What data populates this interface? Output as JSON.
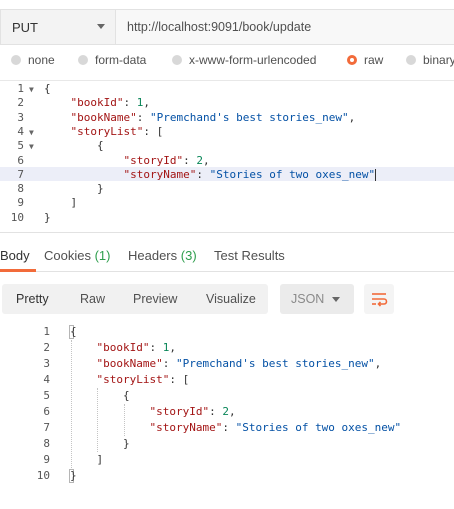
{
  "request": {
    "method": "PUT",
    "url": "http://localhost:9091/book/update"
  },
  "body_types": [
    {
      "label": "none",
      "selected": false
    },
    {
      "label": "form-data",
      "selected": false
    },
    {
      "label": "x-www-form-urlencoded",
      "selected": false
    },
    {
      "label": "raw",
      "selected": true
    },
    {
      "label": "binary",
      "selected": false
    }
  ],
  "request_editor": {
    "line_numbers": [
      "1",
      "2",
      "3",
      "4",
      "5",
      "6",
      "7",
      "8",
      "9",
      "10"
    ],
    "tokens": {
      "brace_open": "{",
      "brace_close": "}",
      "bracket_open": "[",
      "bracket_close": "]",
      "colon": ": ",
      "comma": ",",
      "bookId_key": "\"bookId\"",
      "bookId_val": "1",
      "bookName_key": "\"bookName\"",
      "bookName_val": "\"Premchand's best stories_new\"",
      "storyList_key": "\"storyList\"",
      "storyId_key": "\"storyId\"",
      "storyId_val": "2",
      "storyName_key": "\"storyName\"",
      "storyName_val": "\"Stories of two oxes_new\""
    }
  },
  "response_tabs": {
    "body": "Body",
    "cookies": "Cookies",
    "cookies_count": "(1)",
    "headers": "Headers",
    "headers_count": "(3)",
    "test_results": "Test Results"
  },
  "response_toolbar": {
    "pretty": "Pretty",
    "raw": "Raw",
    "preview": "Preview",
    "visualize": "Visualize",
    "format": "JSON",
    "wrap_icon": "wrap-lines-icon",
    "accent": "#f26b3a"
  },
  "response_body": {
    "line_numbers": [
      "1",
      "2",
      "3",
      "4",
      "5",
      "6",
      "7",
      "8",
      "9",
      "10"
    ]
  }
}
